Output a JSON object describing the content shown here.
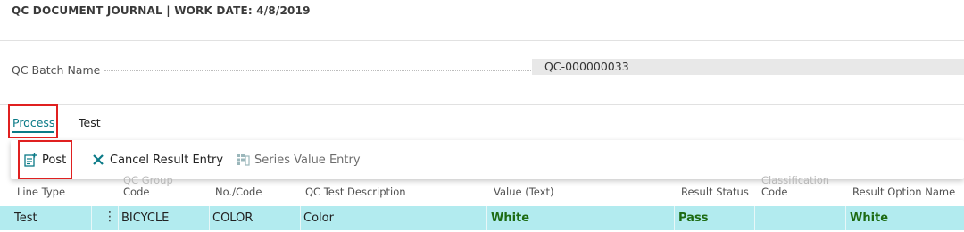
{
  "header": {
    "title": "QC DOCUMENT JOURNAL | WORK DATE: 4/8/2019"
  },
  "batch": {
    "label": "QC Batch Name",
    "value": "QC-000000033"
  },
  "tabs": [
    {
      "label": "Process"
    },
    {
      "label": "Test"
    }
  ],
  "actions": {
    "post_label": "Post",
    "cancel_label": "Cancel Result Entry",
    "series_label": "Series Value Entry"
  },
  "table": {
    "columns": [
      "Line Type",
      "QC Group Code",
      "No./Code",
      "QC Test Description",
      "Value (Text)",
      "Result Status",
      "Classification Code",
      "Result Option Name"
    ],
    "col_group_top": "QC Group",
    "col_group_bottom": "Code",
    "col_class_top": "Classification",
    "col_class_bottom": "Code",
    "row": {
      "line_type": "Test",
      "group_code": "BICYCLE",
      "no_code": "COLOR",
      "description": "Color",
      "value_text": "White",
      "result_status": "Pass",
      "classification_code": "",
      "result_option_name": "White"
    }
  },
  "colors": {
    "accent": "#0a7a87",
    "row_highlight": "#b2ebef",
    "pass_green": "#1d6b13",
    "annotation_red": "#e02020"
  },
  "icons": {
    "post": "post-document-icon",
    "cancel": "close-x-icon",
    "series": "grid-entry-icon"
  }
}
